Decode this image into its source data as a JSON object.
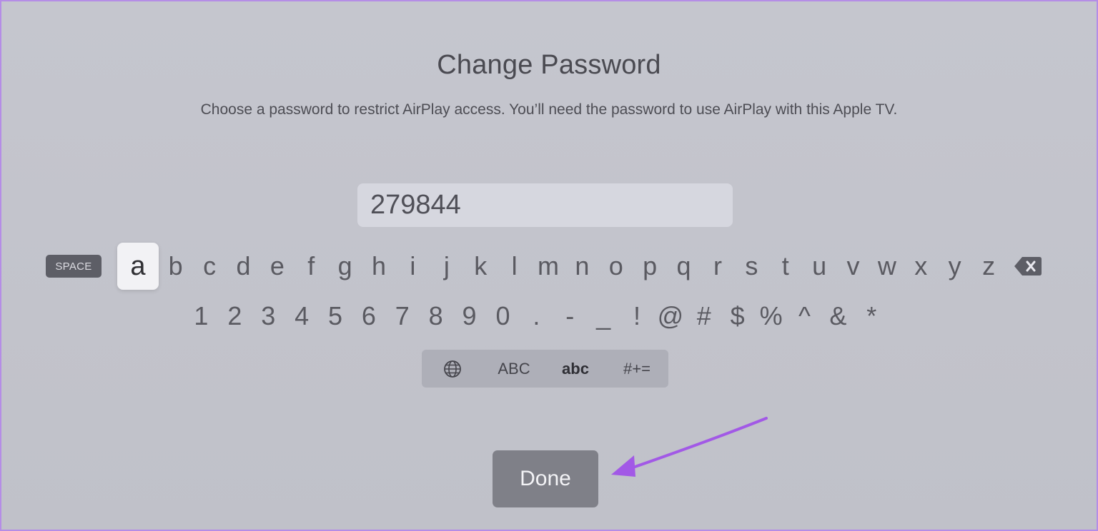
{
  "dialog": {
    "title": "Change Password",
    "subtitle": "Choose a password to restrict AirPlay access. You’ll need the password to use AirPlay with this Apple TV."
  },
  "password_field": {
    "value": "279844"
  },
  "keyboard": {
    "space_label": "SPACE",
    "focused_key": "a",
    "letters": [
      "a",
      "b",
      "c",
      "d",
      "e",
      "f",
      "g",
      "h",
      "i",
      "j",
      "k",
      "l",
      "m",
      "n",
      "o",
      "p",
      "q",
      "r",
      "s",
      "t",
      "u",
      "v",
      "w",
      "x",
      "y",
      "z"
    ],
    "symbols": [
      "1",
      "2",
      "3",
      "4",
      "5",
      "6",
      "7",
      "8",
      "9",
      "0",
      ".",
      "-",
      "_",
      "!",
      "@",
      "#",
      "$",
      "%",
      "^",
      "&",
      "*"
    ],
    "delete_icon": "delete-backward-icon",
    "modes": {
      "globe_icon": "globe-icon",
      "upper": "ABC",
      "lower": "abc",
      "symbols": "#+=",
      "selected": "abc"
    }
  },
  "actions": {
    "done_label": "Done"
  },
  "colors": {
    "background": "#c3c4cc",
    "focused_key": "#f2f2f5",
    "done_button": "#7f8088",
    "annotation_arrow": "#a259e6",
    "frame_border": "#b58de6"
  }
}
